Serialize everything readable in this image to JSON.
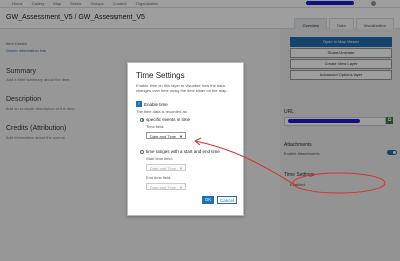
{
  "topbar": {
    "nav": [
      "Home",
      "Gallery",
      "Map",
      "Scene",
      "Groups",
      "Content",
      "Organization"
    ]
  },
  "header": {
    "title": "GW_Assessment_V5 / GW_Assessment_V5"
  },
  "tabs": [
    "Overview",
    "Data",
    "Visualization"
  ],
  "main": {
    "item_label": "Item Details",
    "item_owner": "Owner information link",
    "summary_heading": "Summary",
    "summary_text": "Add a brief summary about the item.",
    "description_heading": "Description",
    "description_text": "Add an in-depth description of the item.",
    "credits_heading": "Credits (Attribution)",
    "credits_text": "Add information about the source"
  },
  "sidebar": {
    "buttons": [
      "Open in Map Viewer",
      "Share/Unshare",
      "Create View Layer",
      "Advanced Options layer"
    ],
    "url_heading": "URL",
    "attachments_heading": "Attachments",
    "enable_attachments": "Enable Attachments",
    "time_settings_heading": "Time Settings",
    "time_settings_value": "Enabled"
  },
  "dialog": {
    "title": "Time Settings",
    "intro": "Enable time on this layer to visualize how the data changes over time using the time slider on the map.",
    "enable_time": "Enable time",
    "recorded_as": "The time data is recorded as:",
    "option_single": "specific events in time",
    "time_field": "Time field:",
    "time_field_value": "Date and Time",
    "option_range": "time ranges with a start and end time",
    "start_field": "Start time field:",
    "start_field_value": "Date and Time",
    "end_field": "End time field:",
    "end_field_value": "Date and Time",
    "ok": "OK",
    "cancel": "Cancel"
  },
  "colors": {
    "accent": "#1f6fb2",
    "annotation": "#d9302e",
    "redaction": "#1a1ad0"
  }
}
